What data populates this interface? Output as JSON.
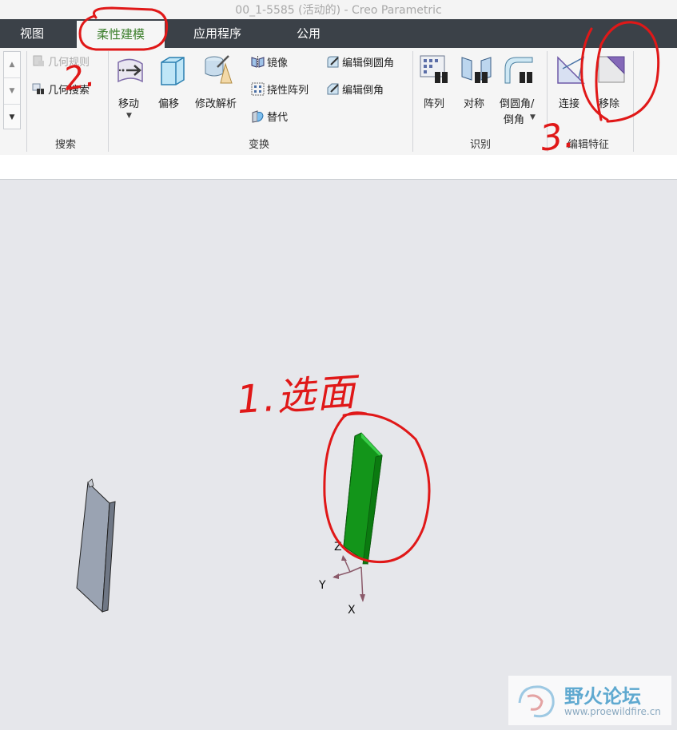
{
  "window": {
    "title": "00_1-5585 (活动的) - Creo Parametric"
  },
  "tabs": [
    {
      "label": "视图"
    },
    {
      "label": "柔性建模",
      "active": true
    },
    {
      "label": "应用程序"
    },
    {
      "label": "公用"
    }
  ],
  "ribbon": {
    "search": {
      "label": "搜索",
      "items": [
        {
          "label": "几何规则",
          "enabled": false
        },
        {
          "label": "几何搜索",
          "enabled": true
        }
      ]
    },
    "transform": {
      "label": "变换",
      "big_buttons": [
        {
          "label": "移动",
          "has_dropdown": true
        },
        {
          "label": "偏移"
        },
        {
          "label": "修改解析"
        }
      ],
      "small_buttons": [
        {
          "label": "镜像"
        },
        {
          "label": "挠性阵列"
        },
        {
          "label": "替代"
        },
        {
          "label": "编辑倒圆角"
        },
        {
          "label": "编辑倒角"
        }
      ]
    },
    "recognize": {
      "label": "识别",
      "buttons": [
        {
          "label": "阵列"
        },
        {
          "label": "对称"
        },
        {
          "label": "倒圆角/",
          "label2": "倒角",
          "has_dropdown": true
        }
      ]
    },
    "edit_features": {
      "label": "编辑特征",
      "buttons": [
        {
          "label": "连接"
        },
        {
          "label": "移除"
        }
      ]
    }
  },
  "viewport": {
    "axes": {
      "z": "Z",
      "y": "Y",
      "x": "X"
    },
    "annotation": {
      "text": "1.选面"
    },
    "marks": [
      "2.",
      "3."
    ],
    "colors": {
      "selected": "#1aa01a",
      "part": "#9aa3b2",
      "annotation": "#e01818"
    }
  },
  "watermark": {
    "title": "野火论坛",
    "url": "www.proewildfire.cn"
  }
}
